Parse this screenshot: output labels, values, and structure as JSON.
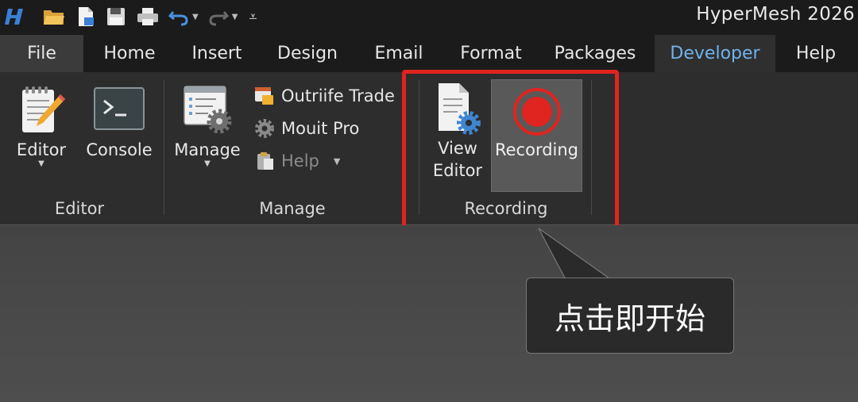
{
  "app": {
    "title": "HyperMesh 2026"
  },
  "quick_access": {
    "icons": [
      "app-logo-icon",
      "open-folder-icon",
      "new-file-icon",
      "save-icon",
      "print-icon",
      "undo-icon",
      "redo-icon",
      "customize-icon"
    ]
  },
  "tabs": [
    {
      "label": "File"
    },
    {
      "label": "Home"
    },
    {
      "label": "Insert"
    },
    {
      "label": "Design"
    },
    {
      "label": "Email"
    },
    {
      "label": "Format"
    },
    {
      "label": "Packages"
    },
    {
      "label": "Developer",
      "active": true
    },
    {
      "label": "Help"
    }
  ],
  "ribbon": {
    "editor_group": {
      "label": "Editor",
      "buttons": [
        {
          "label": "Editor",
          "icon": "notepad-icon"
        },
        {
          "label": "Console",
          "icon": "console-icon"
        }
      ]
    },
    "manage_group": {
      "label": "Manage",
      "manage_button": {
        "label": "Manage",
        "icon": "manage-gear-icon"
      },
      "small_buttons": [
        {
          "label": "Outriife Trade",
          "icon": "trade-icon"
        },
        {
          "label": "Mouit Pro",
          "icon": "gear-icon"
        },
        {
          "label": "Help",
          "icon": "clipboard-icon"
        }
      ]
    },
    "recording_group": {
      "label": "Recording",
      "view_editor": {
        "label_line1": "View",
        "label_line2": "Editor",
        "icon": "view-editor-icon"
      },
      "recording": {
        "label": "Recording",
        "icon": "record-icon"
      }
    }
  },
  "callout": {
    "text": "点击即开始"
  },
  "colors": {
    "highlight": "#e0241f",
    "active_tab": "#6fb3ee",
    "record_red": "#e0241f"
  }
}
